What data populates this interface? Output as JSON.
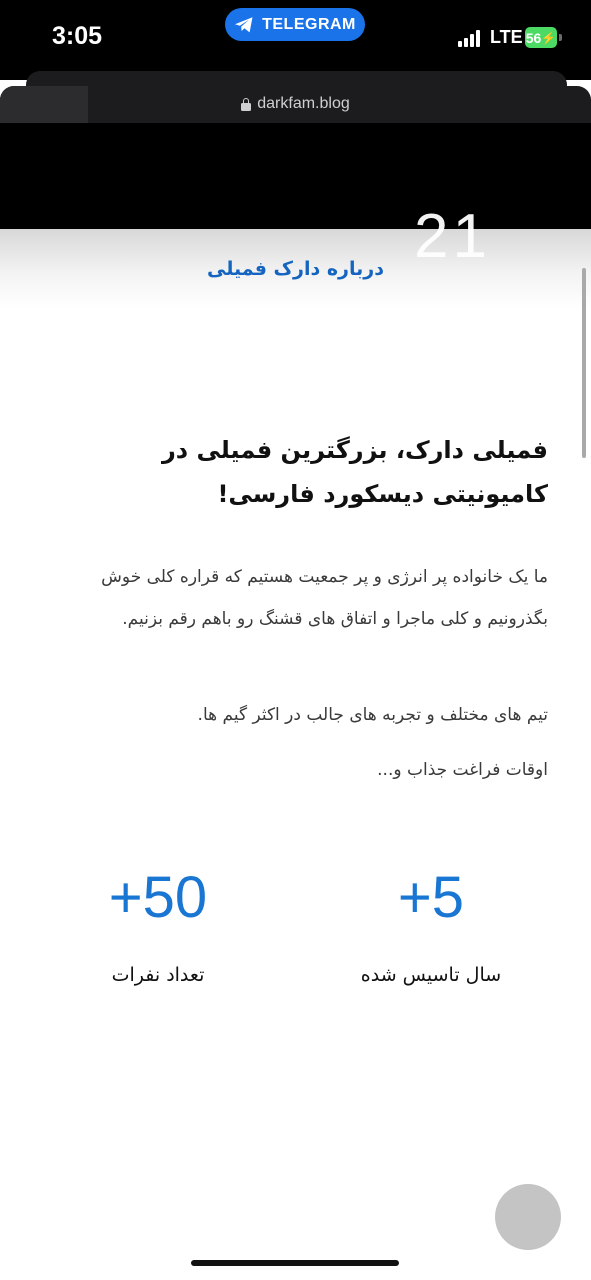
{
  "status_bar": {
    "time": "3:05",
    "back_app_label": "TELEGRAM",
    "network": "LTE",
    "battery": "56"
  },
  "browser": {
    "url": "darkfam.blog"
  },
  "page": {
    "ghost_digits": "21",
    "section_title": "درباره دارک فمیلی",
    "headline": "فمیلی دارک، بزرگترین فمیلی در کامیونیتی دیسکورد فارسی!",
    "paragraphs": [
      "ما یک خانواده پر انرژی و پر جمعیت هستیم که قراره کلی خوش بگذرونیم و کلی ماجرا و اتفاق های قشنگ رو باهم رقم بزنیم.",
      "تیم های مختلف و تجربه های جالب در اکثر گیم ها.",
      "اوقات فراغت جذاب و..."
    ],
    "stats": {
      "members": {
        "value": "+50",
        "label": "تعداد نفرات"
      },
      "years": {
        "value": "+5",
        "label": "سال تاسیس شده"
      }
    }
  },
  "colors": {
    "accent": "#1976d2",
    "telegram_pill": "#1a73e8",
    "battery": "#4cd964"
  }
}
